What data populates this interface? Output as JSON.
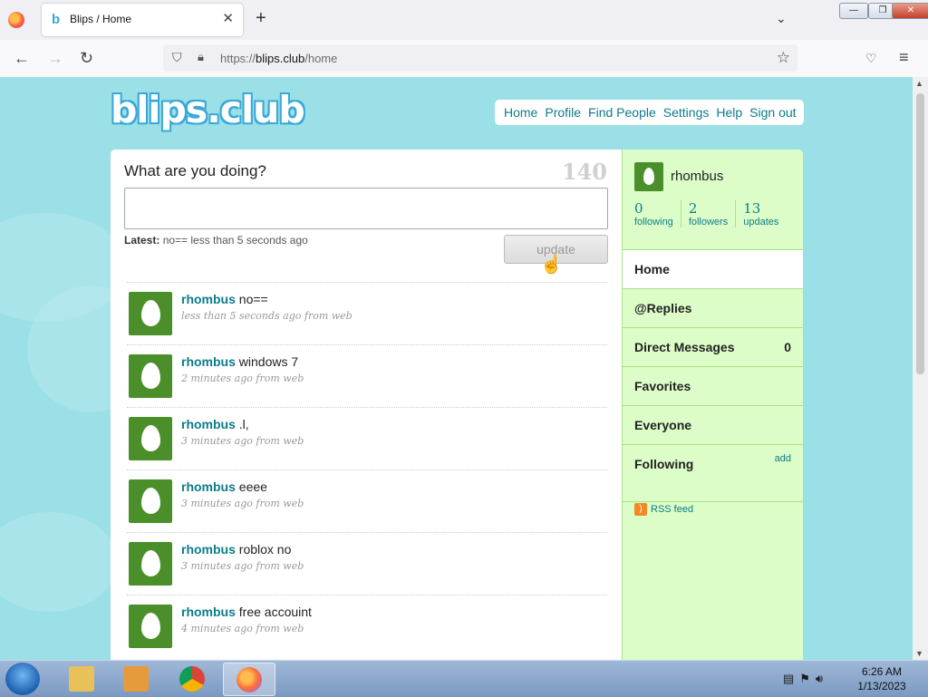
{
  "browser": {
    "tab_title": "Blips / Home",
    "tab_favicon": "b",
    "url_prefix": "https://",
    "url_domain": "blips.club",
    "url_path": "/home"
  },
  "site": {
    "logo": "blips.club",
    "nav": [
      "Home",
      "Profile",
      "Find People",
      "Settings",
      "Help",
      "Sign out"
    ]
  },
  "composer": {
    "prompt": "What are you doing?",
    "char_count": "140",
    "value": "",
    "latest_label": "Latest:",
    "latest_text": "no== less than 5 seconds ago",
    "update_label": "update"
  },
  "stream": [
    {
      "user": "rhombus",
      "text": "no==",
      "meta": "less than 5 seconds ago from web"
    },
    {
      "user": "rhombus",
      "text": "windows 7",
      "meta": "2 minutes ago from web"
    },
    {
      "user": "rhombus",
      "text": ".l,",
      "meta": "3 minutes ago from web"
    },
    {
      "user": "rhombus",
      "text": "eeee",
      "meta": "3 minutes ago from web"
    },
    {
      "user": "rhombus",
      "text": "roblox no",
      "meta": "3 minutes ago from web"
    },
    {
      "user": "rhombus",
      "text": "free accouint",
      "meta": "4 minutes ago from web"
    }
  ],
  "sidebar": {
    "username": "rhombus",
    "stats": [
      {
        "num": "0",
        "label": "following"
      },
      {
        "num": "2",
        "label": "followers"
      },
      {
        "num": "13",
        "label": "updates"
      }
    ],
    "menu": [
      {
        "label": "Home"
      },
      {
        "label": "@Replies"
      },
      {
        "label": "Direct Messages",
        "count": "0"
      },
      {
        "label": "Favorites"
      },
      {
        "label": "Everyone"
      },
      {
        "label": "Following",
        "extra": "add"
      }
    ],
    "rss": "RSS feed"
  },
  "taskbar": {
    "time": "6:26 AM",
    "date": "1/13/2023"
  },
  "colors": {
    "page_bg": "#9ae0e6",
    "link": "#0c7c8a",
    "sidebar_bg": "#ddfdc8",
    "avatar": "#4a8f2a"
  }
}
